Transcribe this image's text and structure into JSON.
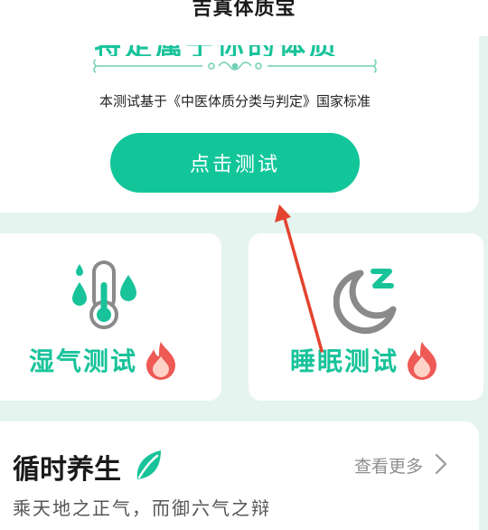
{
  "app": {
    "title": "吉真体质宝"
  },
  "hero": {
    "heading": "特定属于你的体质",
    "subtitle": "本测试基于《中医体质分类与判定》国家标准",
    "button_label": "点击测试"
  },
  "tests": [
    {
      "label": "湿气测试",
      "icon": "thermometer-droplets-icon",
      "badge": "fire-icon"
    },
    {
      "label": "睡眠测试",
      "icon": "moon-zzz-icon",
      "badge": "fire-icon"
    }
  ],
  "section": {
    "title": "循时养生",
    "icon": "leaf-icon",
    "more_label": "查看更多",
    "slogan": "乘天地之正气，而御六气之辩"
  },
  "colors": {
    "accent": "#12c69a",
    "label_green": "#18c39a",
    "background": "#e6f4ef",
    "annotation_arrow": "#e4432f"
  }
}
